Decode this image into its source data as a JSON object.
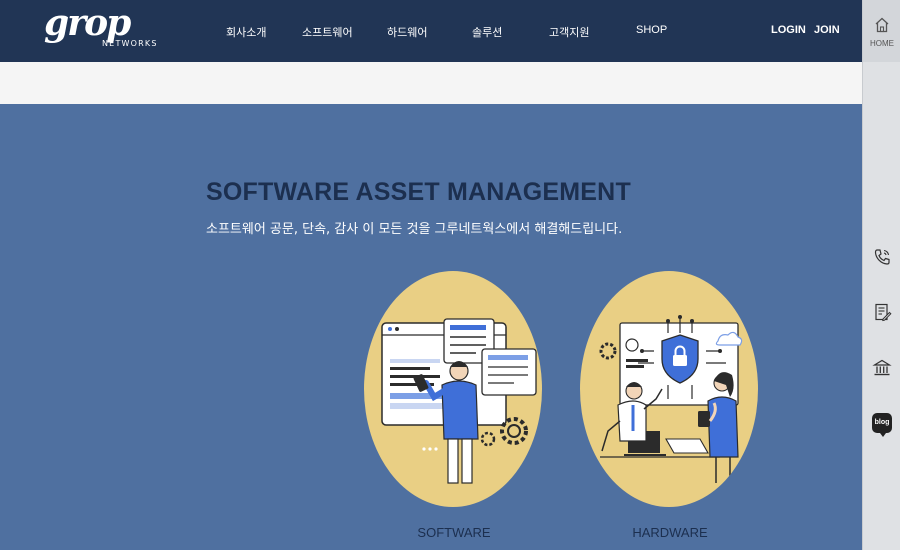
{
  "header": {
    "logo_script": "grop",
    "logo_sub": "NETWORKS",
    "nav": [
      {
        "label": "회사소개"
      },
      {
        "label": "소프트웨어"
      },
      {
        "label": "하드웨어"
      },
      {
        "label": "솔루션"
      },
      {
        "label": "고객지원"
      },
      {
        "label": "SHOP"
      }
    ],
    "login": "LOGIN",
    "join": "JOIN"
  },
  "rail": {
    "home_label": "HOME",
    "blog_label": "blog",
    "icons": [
      "home-icon",
      "phone-icon",
      "document-edit-icon",
      "bank-icon",
      "blog-icon"
    ]
  },
  "hero": {
    "title": "SOFTWARE ASSET MANAGEMENT",
    "subtitle": "소프트웨어 공문, 단속, 감사 이 모든 것을 그루네트웍스에서 해결해드립니다."
  },
  "cards": [
    {
      "label": "SOFTWARE"
    },
    {
      "label": "HARDWARE"
    }
  ],
  "colors": {
    "header_bg": "#213555",
    "hero_bg": "#4f70a0",
    "circle": "#e9cf84",
    "title": "#1c2f4f",
    "accent_blue": "#3f6fd8"
  }
}
